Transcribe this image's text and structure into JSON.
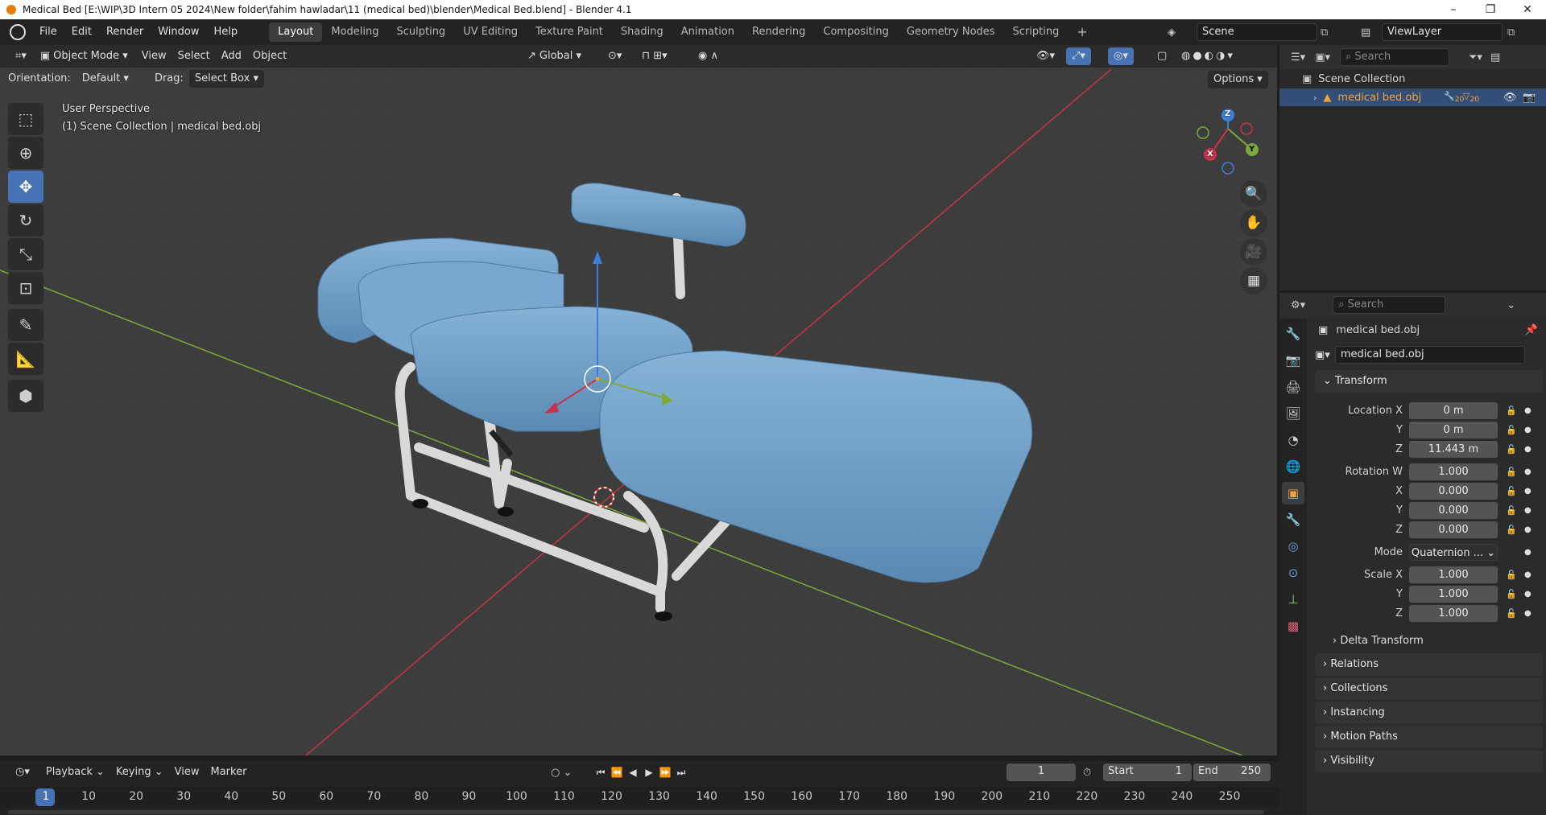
{
  "window": {
    "title": "Medical Bed [E:\\WIP\\3D Intern 05 2024\\New folder\\fahim hawladar\\11 (medical bed)\\blender\\Medical Bed.blend] - Blender 4.1",
    "controls": {
      "minimize": "–",
      "restore": "❐",
      "close": "✕"
    }
  },
  "menubar": {
    "items": [
      "File",
      "Edit",
      "Render",
      "Window",
      "Help"
    ],
    "workspaces": [
      "Layout",
      "Modeling",
      "Sculpting",
      "UV Editing",
      "Texture Paint",
      "Shading",
      "Animation",
      "Rendering",
      "Compositing",
      "Geometry Nodes",
      "Scripting"
    ],
    "active_workspace": "Layout",
    "add_tab": "+",
    "scene": "Scene",
    "view_layer": "ViewLayer"
  },
  "viewport": {
    "mode": "Object Mode",
    "menus": [
      "View",
      "Select",
      "Add",
      "Object"
    ],
    "transform_orientation": "Global",
    "orientation_label": "Orientation:",
    "orientation_value": "Default",
    "drag_label": "Drag:",
    "drag_value": "Select Box",
    "options": "Options",
    "perspective": "User Perspective",
    "collection_info": "(1) Scene Collection | medical bed.obj",
    "gizmo": {
      "x": "X",
      "y": "Y",
      "z": "Z"
    },
    "colors": {
      "bed": "#6f9fc7",
      "frame": "#d8d8d8",
      "x_axis": "#c8324a",
      "y_axis": "#7fa83a",
      "z_axis": "#3c7fd8"
    }
  },
  "outliner": {
    "search_placeholder": "Search",
    "root": "Scene Collection",
    "items": [
      {
        "name": "medical bed.obj",
        "modifier_count": "20",
        "mesh_count": "20"
      }
    ]
  },
  "properties": {
    "search_placeholder": "Search",
    "object_name": "medical bed.obj",
    "object_selector": "medical bed.obj",
    "transform": {
      "title": "Transform",
      "location_label": "Location X",
      "location": [
        "0 m",
        "0 m",
        "11.443 m"
      ],
      "rotation_label": "Rotation W",
      "rotation": [
        "1.000",
        "0.000",
        "0.000",
        "0.000"
      ],
      "mode_label": "Mode",
      "mode": "Quaternion ...",
      "scale_label": "Scale X",
      "scale": [
        "1.000",
        "1.000",
        "1.000"
      ],
      "axis_y": "Y",
      "axis_z": "Z",
      "axis_x": "X"
    },
    "delta_transform": "Delta Transform",
    "panels": [
      "Relations",
      "Collections",
      "Instancing",
      "Motion Paths",
      "Visibility"
    ]
  },
  "timeline": {
    "menus": [
      "Playback",
      "Keying",
      "View",
      "Marker"
    ],
    "current_frame": "1",
    "start_label": "Start",
    "start": "1",
    "end_label": "End",
    "end": "250",
    "ruler": [
      "1",
      "10",
      "20",
      "30",
      "40",
      "50",
      "60",
      "70",
      "80",
      "90",
      "100",
      "110",
      "120",
      "130",
      "140",
      "150",
      "160",
      "170",
      "180",
      "190",
      "200",
      "210",
      "220",
      "230",
      "240",
      "250"
    ]
  }
}
